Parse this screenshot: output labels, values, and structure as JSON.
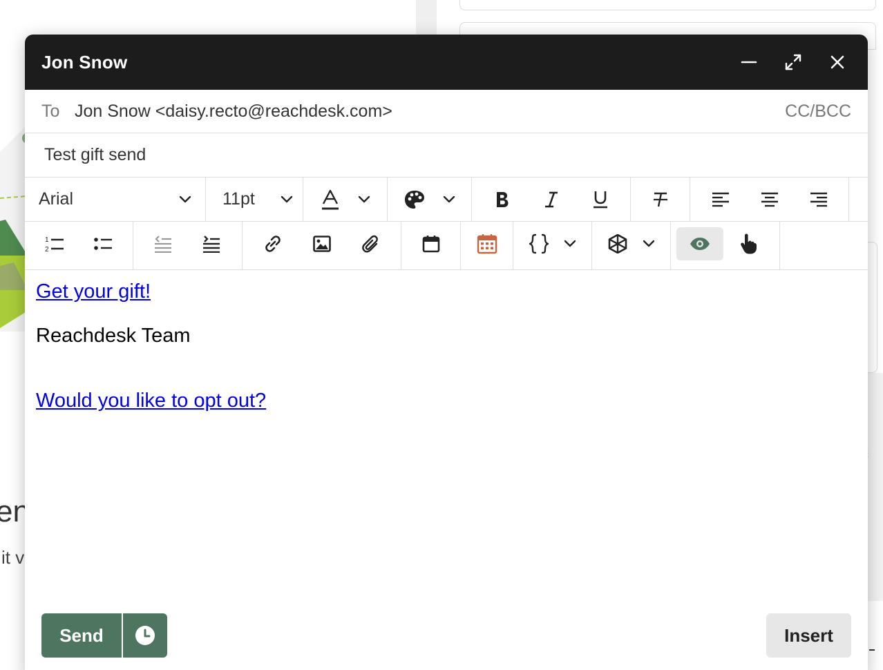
{
  "compose": {
    "title": "Jon Snow",
    "to_label": "To",
    "to_value": "Jon Snow <daisy.recto@reachdesk.com>",
    "cc_bcc": "CC/BCC",
    "subject": "Test gift send"
  },
  "toolbar": {
    "font_family": "Arial",
    "font_size": "11pt",
    "calendar_accent_color": "#c9643e",
    "preview_active_color": "#4d7560"
  },
  "body": {
    "gift_link": "Get your gift!",
    "signature": "Reachdesk Team",
    "optout_link": "Would you like to opt out?"
  },
  "footer": {
    "send_label": "Send",
    "insert_label": "Insert"
  },
  "background": {
    "partial_heading": "en",
    "partial_text": "it v"
  }
}
